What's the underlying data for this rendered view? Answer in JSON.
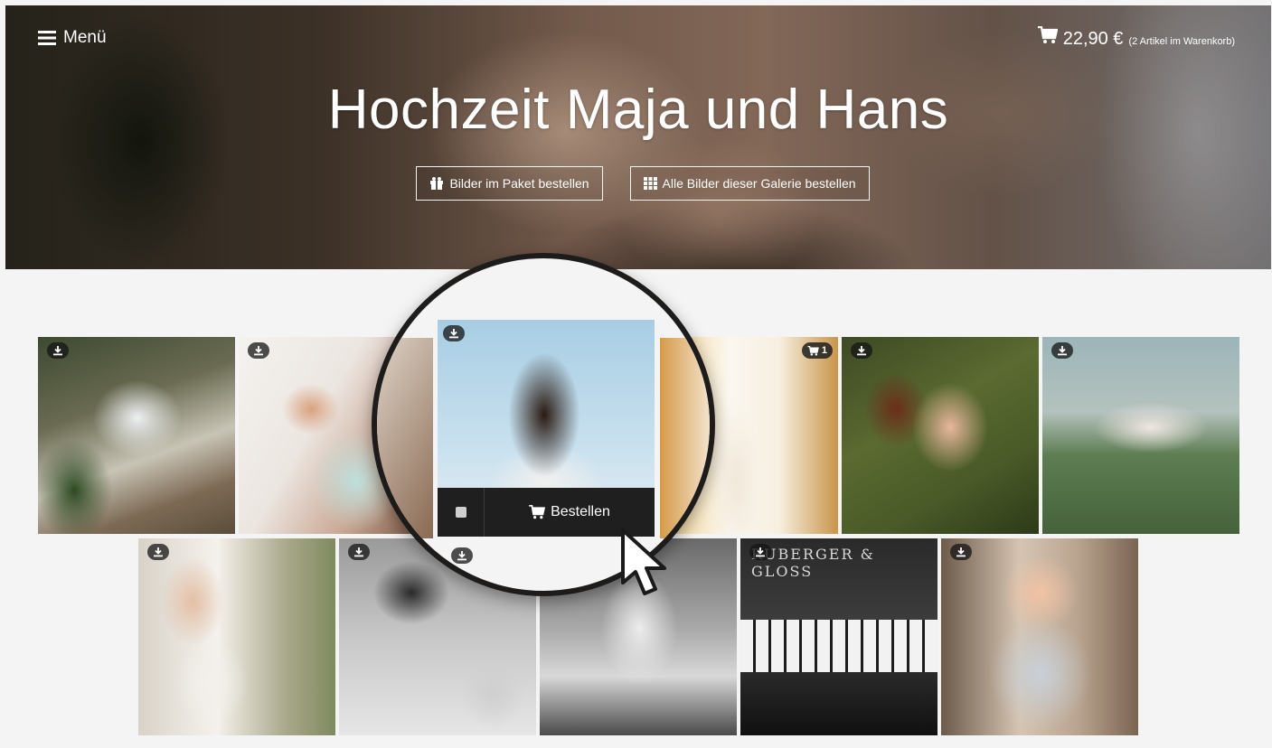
{
  "header": {
    "menu_label": "Menü",
    "cart_amount": "22,90 €",
    "cart_count_text": "(2 Artikel im Warenkorb)"
  },
  "hero": {
    "title": "Hochzeit Maja und Hans",
    "package_button": "Bilder im Paket bestellen",
    "all_button": "Alle Bilder dieser Galerie bestellen"
  },
  "gallery": {
    "cart_badge_count": "1",
    "order_button": "Bestellen",
    "piano_brand_text": "RUBERGER & GLOSS"
  },
  "icons": {
    "menu": "hamburger-icon",
    "cart": "cart-icon",
    "package": "gift-icon",
    "grid": "grid-icon",
    "download": "download-icon",
    "cursor": "pointer-cursor-icon"
  },
  "colors": {
    "page_background": "#f4f4f4",
    "order_bar": "#1f1f1f",
    "badge": "#2a2a2a",
    "text_light": "#ffffff"
  }
}
